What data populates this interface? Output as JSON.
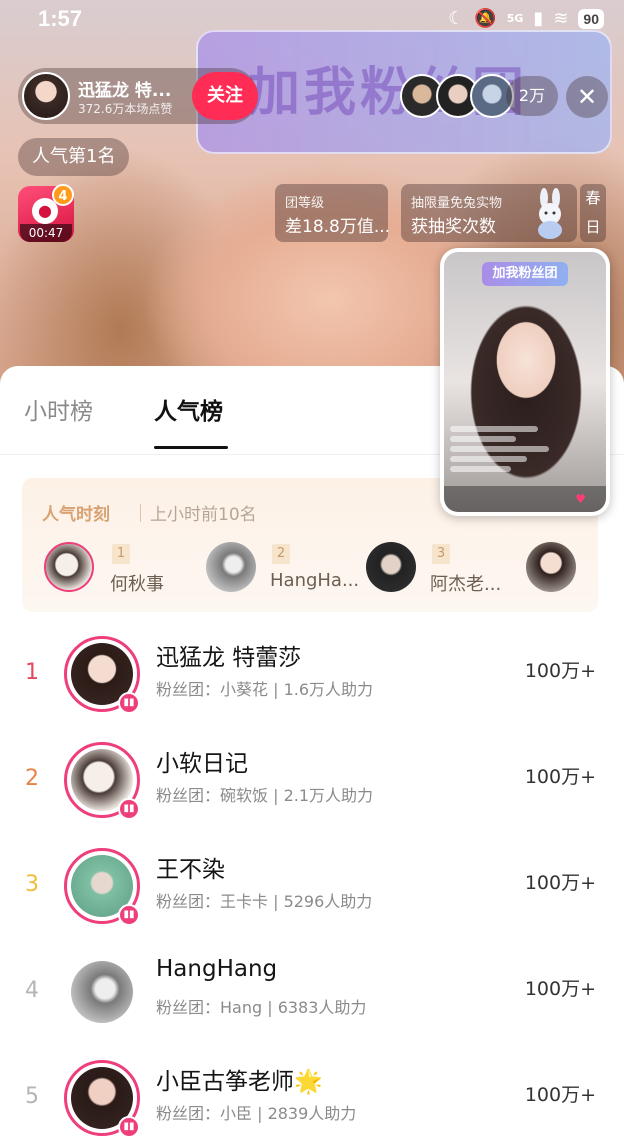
{
  "status_bar": {
    "time": "1:57",
    "network": "5G",
    "battery": "90"
  },
  "stream": {
    "banner_text": "加我粉丝团",
    "host_name": "迅猛龙 特...",
    "host_likes": "372.6万本场点赞",
    "follow_label": "关注",
    "viewer_count": "2万",
    "close_glyph": "✕",
    "rank_label": "人气第1名",
    "gift_badge": "4",
    "gift_timer": "00:47",
    "level_card": {
      "title": "团等级",
      "value": "差18.8万值..."
    },
    "lottery_card": {
      "title": "抽限量免兔实物",
      "value": "获抽奖次数"
    },
    "spring_card": {
      "line1": "春",
      "line2": "日"
    }
  },
  "mini_player": {
    "banner_text": "加我粉丝团"
  },
  "tabs": [
    {
      "label": "小时榜",
      "active": false
    },
    {
      "label": "人气榜",
      "active": true
    }
  ],
  "moment": {
    "title": "人气时刻",
    "subtitle": "上小时前10名",
    "items": [
      {
        "rank": "1",
        "name": "何秋事"
      },
      {
        "rank": "2",
        "name": "HangHa..."
      },
      {
        "rank": "3",
        "name": "阿杰老..."
      }
    ]
  },
  "ranking": [
    {
      "rank": "1",
      "name": "迅猛龙 特蕾莎",
      "sub": "粉丝团：小葵花 | 1.6万人助力",
      "score": "100万+",
      "rank_color": "#e5485f",
      "live": true
    },
    {
      "rank": "2",
      "name": "小软日记",
      "sub": "粉丝团：碗软饭 | 2.1万人助力",
      "score": "100万+",
      "rank_color": "#e8834a",
      "live": true
    },
    {
      "rank": "3",
      "name": "王不染",
      "sub": "粉丝团：王卡卡 | 5296人助力",
      "score": "100万+",
      "rank_color": "#f0be3a",
      "live": true
    },
    {
      "rank": "4",
      "name": "HangHang",
      "sub": "粉丝团：Hang | 6383人助力",
      "score": "100万+",
      "rank_color": "#b5b5b5",
      "live": false
    },
    {
      "rank": "5",
      "name": "小臣古筝老师🌟",
      "sub": "粉丝团：小臣 | 2839人助力",
      "score": "100万+",
      "rank_color": "#b5b5b5",
      "live": true
    }
  ],
  "colors": {
    "accent": "#ff2d55",
    "live_ring": "#ee3f7c",
    "moment_title": "#d9a273"
  }
}
